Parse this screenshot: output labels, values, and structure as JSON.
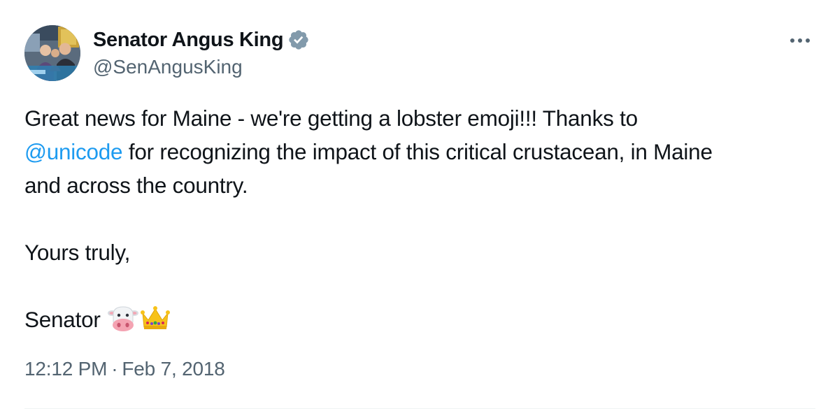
{
  "tweet": {
    "author": {
      "name": "Senator Angus King",
      "handle": "@SenAngusKing",
      "verified": true,
      "verified_color": "#829aab"
    },
    "menu_icon": "more-horizontal-icon",
    "text": {
      "line1": "Great news for Maine - we're getting a lobster emoji!!! Thanks to",
      "mention": "@unicode",
      "line2_rest": " for recognizing the impact of this critical crustacean, in Maine",
      "line3": "and across the country.",
      "closing": "Yours truly,",
      "signature": "Senator",
      "signature_emojis": [
        "cow-face-emoji",
        "crown-emoji"
      ]
    },
    "time": "12:12 PM",
    "separator": "·",
    "date": "Feb 7, 2018",
    "colors": {
      "text": "#0f1419",
      "secondary": "#536471",
      "link": "#1d9bf0"
    }
  }
}
